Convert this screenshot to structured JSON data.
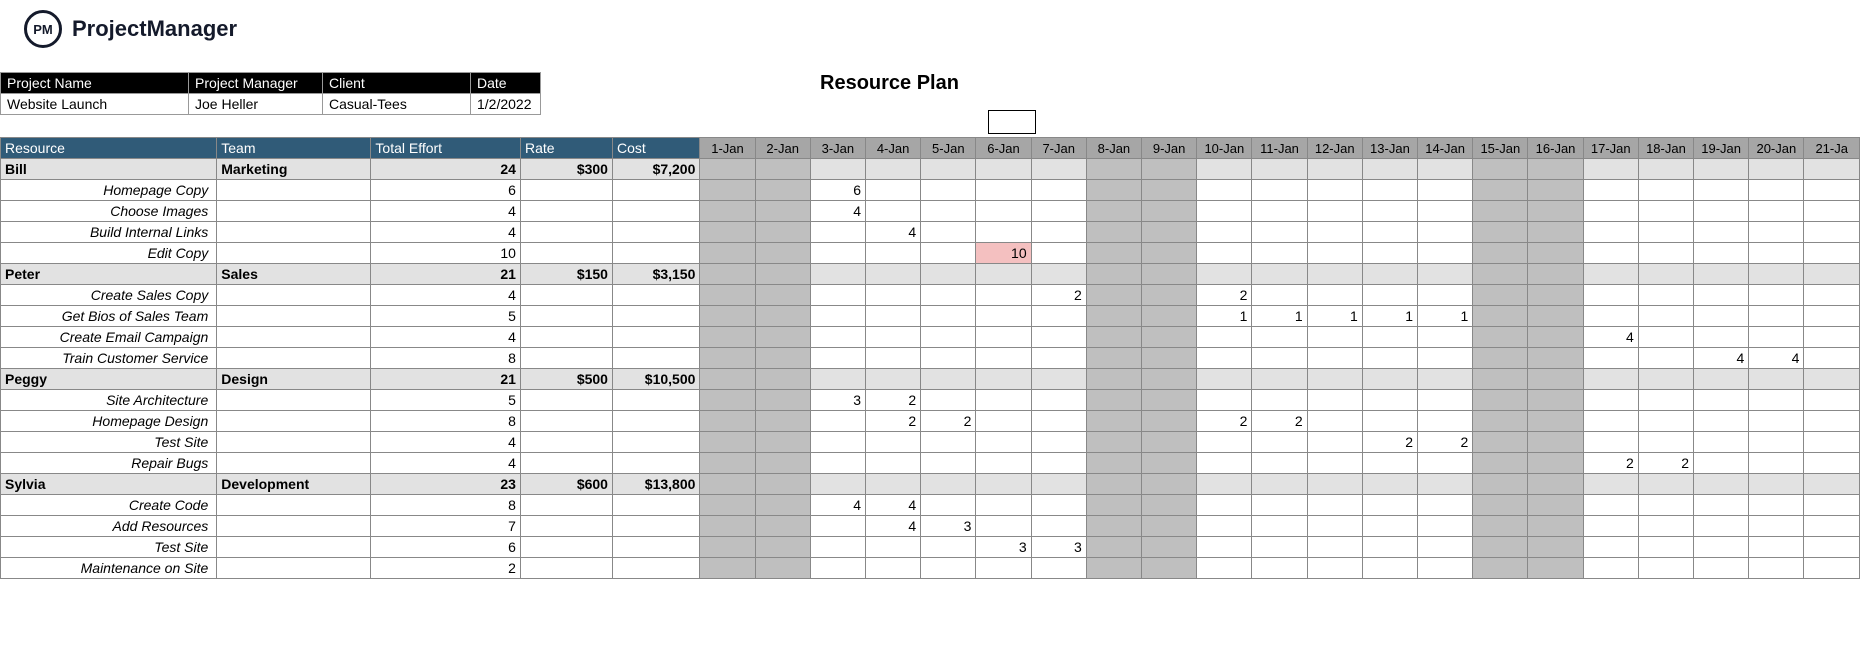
{
  "brand": {
    "initials": "PM",
    "name": "ProjectManager"
  },
  "title": "Resource Plan",
  "meta": {
    "headers": [
      "Project Name",
      "Project Manager",
      "Client",
      "Date"
    ],
    "values": [
      "Website Launch",
      "Joe Heller",
      "Casual-Tees",
      "1/2/2022"
    ]
  },
  "columns": {
    "resource": "Resource",
    "team": "Team",
    "effort": "Total Effort",
    "rate": "Rate",
    "cost": "Cost"
  },
  "days": [
    "1-Jan",
    "2-Jan",
    "3-Jan",
    "4-Jan",
    "5-Jan",
    "6-Jan",
    "7-Jan",
    "8-Jan",
    "9-Jan",
    "10-Jan",
    "11-Jan",
    "12-Jan",
    "13-Jan",
    "14-Jan",
    "15-Jan",
    "16-Jan",
    "17-Jan",
    "18-Jan",
    "19-Jan",
    "20-Jan",
    "21-Ja"
  ],
  "weekend_cols": [
    0,
    1,
    7,
    8,
    14,
    15
  ],
  "resources": [
    {
      "name": "Bill",
      "team": "Marketing",
      "effort": "24",
      "rate": "$300",
      "cost": "$7,200",
      "tasks": [
        {
          "name": "Homepage Copy",
          "effort": "6",
          "cells": {
            "2": "6"
          }
        },
        {
          "name": "Choose Images",
          "effort": "4",
          "cells": {
            "2": "4"
          }
        },
        {
          "name": "Build Internal Links",
          "effort": "4",
          "cells": {
            "3": "4"
          }
        },
        {
          "name": "Edit Copy",
          "effort": "10",
          "cells": {
            "5": "10"
          },
          "alert": [
            "5"
          ]
        }
      ]
    },
    {
      "name": "Peter",
      "team": "Sales",
      "effort": "21",
      "rate": "$150",
      "cost": "$3,150",
      "tasks": [
        {
          "name": "Create Sales Copy",
          "effort": "4",
          "cells": {
            "6": "2",
            "9": "2"
          }
        },
        {
          "name": "Get Bios of Sales Team",
          "effort": "5",
          "cells": {
            "9": "1",
            "10": "1",
            "11": "1",
            "12": "1",
            "13": "1"
          }
        },
        {
          "name": "Create Email Campaign",
          "effort": "4",
          "cells": {
            "16": "4"
          }
        },
        {
          "name": "Train Customer Service",
          "effort": "8",
          "cells": {
            "18": "4",
            "19": "4"
          }
        }
      ]
    },
    {
      "name": "Peggy",
      "team": "Design",
      "effort": "21",
      "rate": "$500",
      "cost": "$10,500",
      "tasks": [
        {
          "name": "Site Architecture",
          "effort": "5",
          "cells": {
            "2": "3",
            "3": "2"
          }
        },
        {
          "name": "Homepage Design",
          "effort": "8",
          "cells": {
            "3": "2",
            "4": "2",
            "9": "2",
            "10": "2"
          }
        },
        {
          "name": "Test Site",
          "effort": "4",
          "cells": {
            "12": "2",
            "13": "2"
          }
        },
        {
          "name": "Repair Bugs",
          "effort": "4",
          "cells": {
            "16": "2",
            "17": "2"
          }
        }
      ]
    },
    {
      "name": "Sylvia",
      "team": "Development",
      "effort": "23",
      "rate": "$600",
      "cost": "$13,800",
      "tasks": [
        {
          "name": "Create Code",
          "effort": "8",
          "cells": {
            "2": "4",
            "3": "4"
          }
        },
        {
          "name": "Add Resources",
          "effort": "7",
          "cells": {
            "3": "4",
            "4": "3"
          }
        },
        {
          "name": "Test Site",
          "effort": "6",
          "cells": {
            "5": "3",
            "6": "3"
          }
        },
        {
          "name": "Maintenance on Site",
          "effort": "2",
          "cells": {}
        }
      ]
    }
  ]
}
